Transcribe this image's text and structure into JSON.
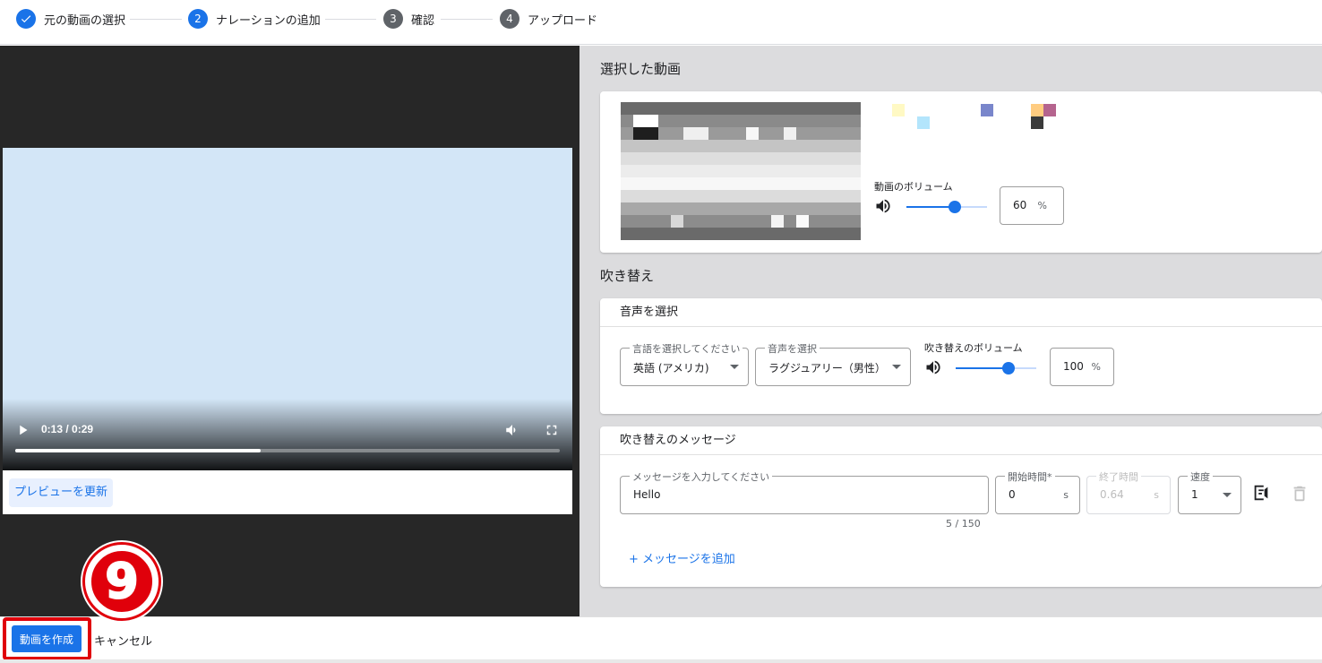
{
  "stepper": {
    "steps": [
      {
        "num": "✓",
        "label": "元の動画の選択"
      },
      {
        "num": "2",
        "label": "ナレーションの追加"
      },
      {
        "num": "3",
        "label": "確認"
      },
      {
        "num": "4",
        "label": "アップロード"
      }
    ]
  },
  "player": {
    "time": "0:13 / 0:29",
    "progress_fraction": 0.45,
    "preview_button": "プレビューを更新"
  },
  "selected_video": {
    "title": "選択した動画",
    "volume_label": "動画のボリューム",
    "volume_value": "60",
    "volume_unit": "%",
    "volume_fraction": 0.6
  },
  "dubbing": {
    "title": "吹き替え",
    "voice_card": {
      "header": "音声を選択",
      "language_label": "言語を選択してください",
      "language_value": "英語 (アメリカ)",
      "voice_label": "音声を選択",
      "voice_value": "ラグジュアリー（男性）",
      "dub_volume_label": "吹き替えのボリューム",
      "dub_volume_value": "100",
      "dub_volume_unit": "%",
      "dub_volume_fraction": 0.65
    },
    "message_card": {
      "header": "吹き替えのメッセージ",
      "message_label": "メッセージを入力してください",
      "message_value": "Hello",
      "char_count": "5 / 150",
      "start_label": "開始時間*",
      "start_value": "0",
      "start_unit": "s",
      "end_label": "終了時間",
      "end_value": "0.64",
      "end_unit": "s",
      "speed_label": "速度",
      "speed_value": "1",
      "add_message": "+ メッセージを追加"
    }
  },
  "footer": {
    "create_button": "動画を作成",
    "cancel_button": "キャンセル"
  },
  "annotation": {
    "number": "9"
  },
  "colors": {
    "accent": "#1a73e8",
    "annotation_red": "#e0000b",
    "player_bg": "#272727",
    "video_frame": "#d3e6f7"
  }
}
